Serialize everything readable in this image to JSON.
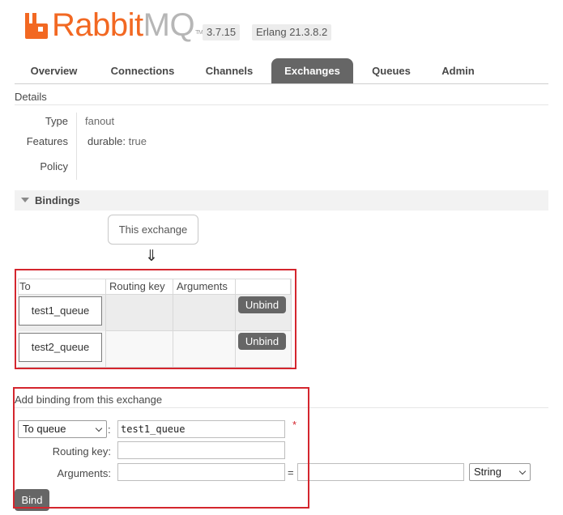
{
  "header": {
    "brand_rabbit": "Rabbit",
    "brand_mq": "MQ",
    "brand_tm": "TM",
    "version": "3.7.15",
    "erlang": "Erlang 21.3.8.2",
    "colors": {
      "brand_orange": "#f26822",
      "tab_active": "#666666",
      "highlight_red": "#d4262e"
    }
  },
  "nav": {
    "tabs": [
      {
        "label": "Overview",
        "active": false
      },
      {
        "label": "Connections",
        "active": false
      },
      {
        "label": "Channels",
        "active": false
      },
      {
        "label": "Exchanges",
        "active": true
      },
      {
        "label": "Queues",
        "active": false
      },
      {
        "label": "Admin",
        "active": false
      }
    ]
  },
  "details": {
    "title": "Details",
    "type_label": "Type",
    "type_value": "fanout",
    "features_label": "Features",
    "features_key": "durable:",
    "features_value": "true",
    "policy_label": "Policy"
  },
  "bindings": {
    "title": "Bindings",
    "this_exchange": "This exchange",
    "arrow": "⇓",
    "columns": [
      "To",
      "Routing key",
      "Arguments"
    ],
    "rows": [
      {
        "to": "test1_queue",
        "routing_key": "",
        "arguments": "",
        "action": "Unbind"
      },
      {
        "to": "test2_queue",
        "routing_key": "",
        "arguments": "",
        "action": "Unbind"
      }
    ]
  },
  "add_binding": {
    "title": "Add binding from this exchange",
    "destination_type": "To queue",
    "colon": ":",
    "destination_value": "test1_queue",
    "required_mark": "*",
    "routing_key_label": "Routing key:",
    "routing_key_value": "",
    "arguments_label": "Arguments:",
    "argument_key": "",
    "equals": "=",
    "argument_value": "",
    "argument_type": "String",
    "bind_button": "Bind"
  }
}
